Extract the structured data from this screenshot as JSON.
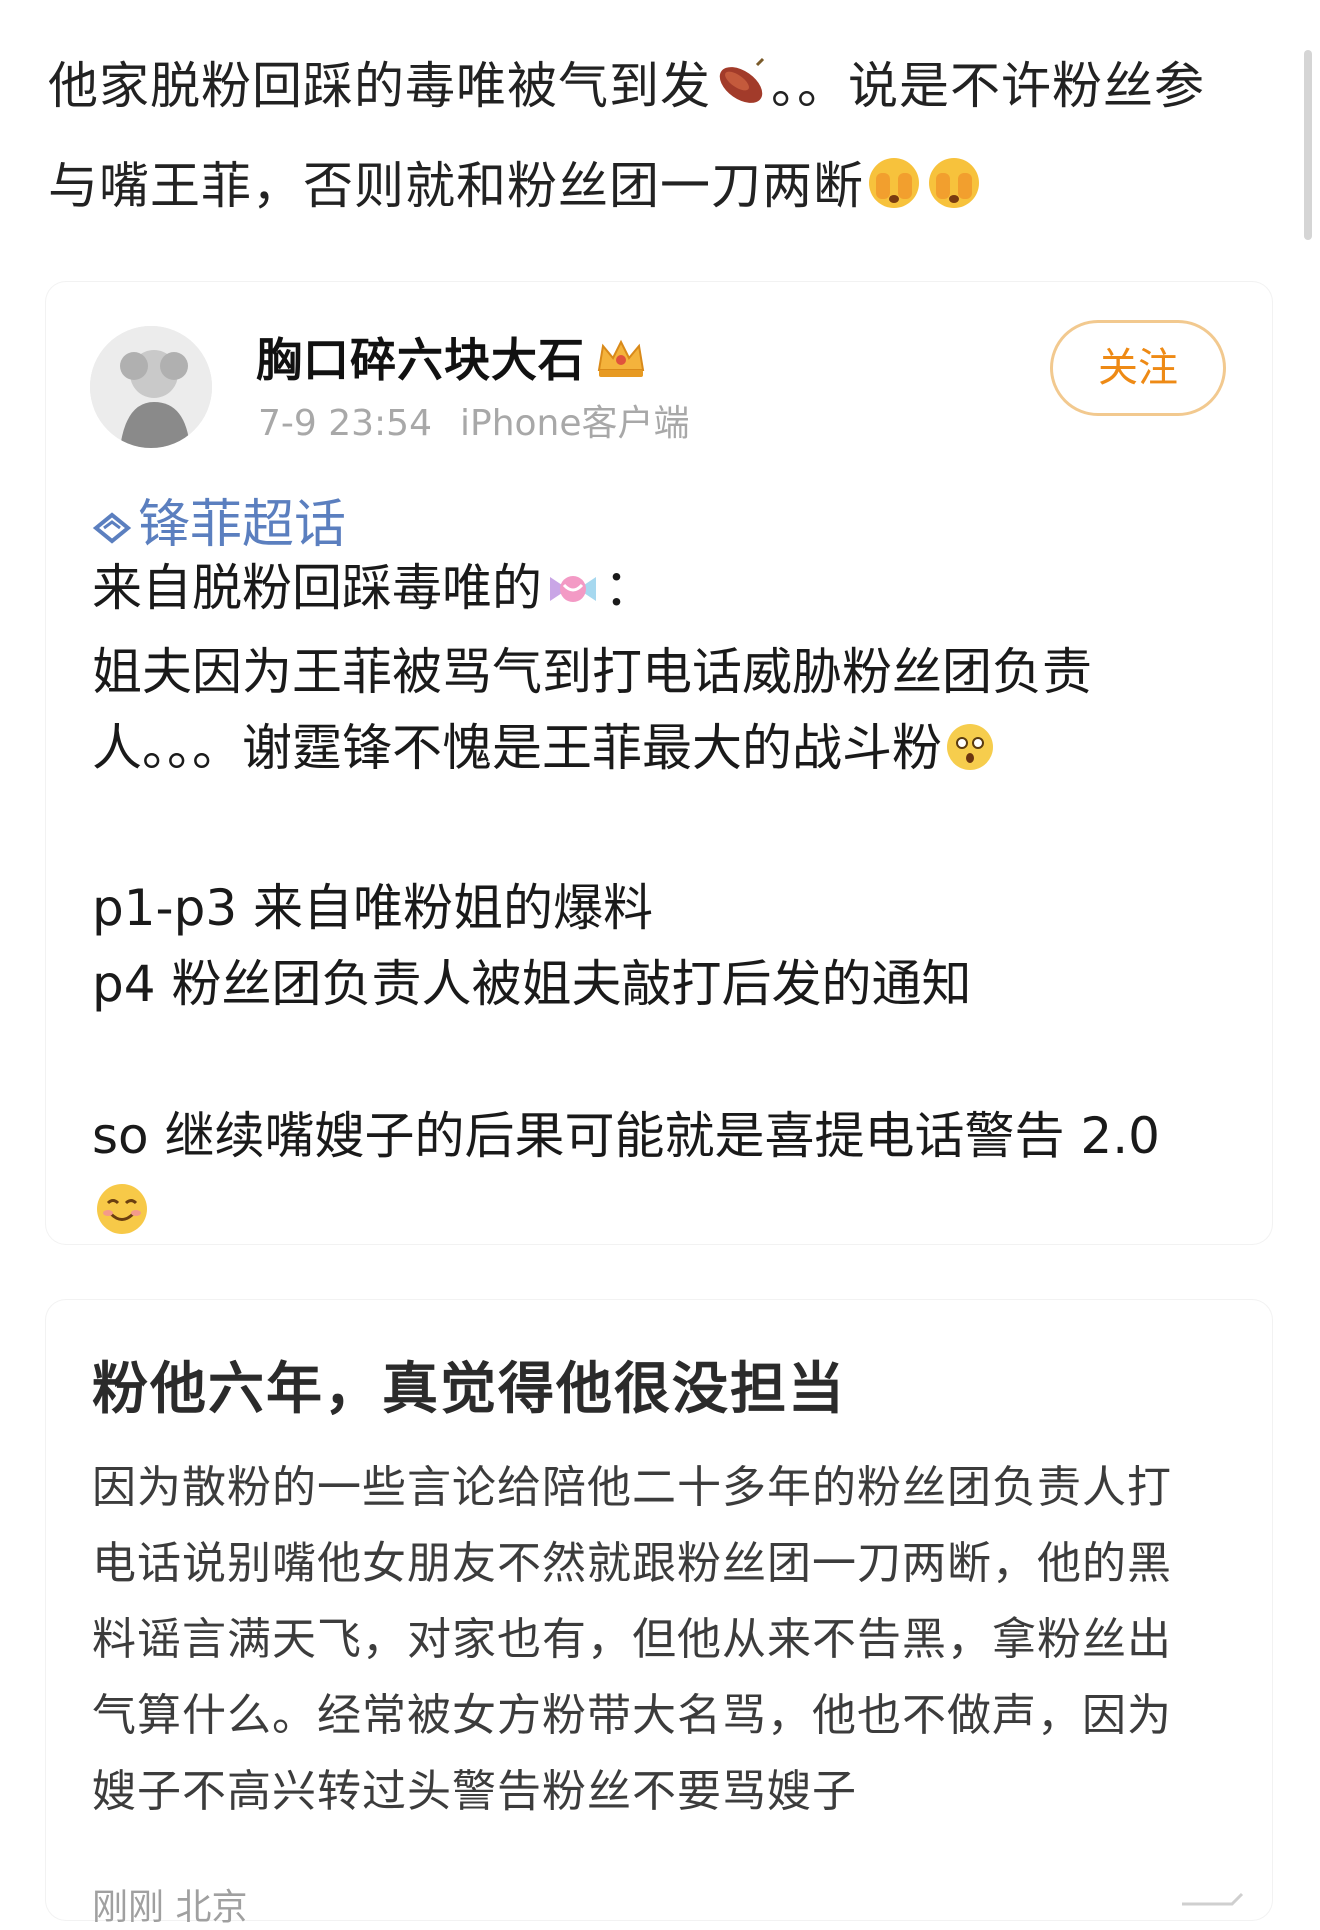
{
  "intro": {
    "line1": "他家脱粉回踩的毒唯被气到发",
    "line1_tail": "。。说是不许粉丝参",
    "line2": "与嘴王菲，否则就和粉丝团一刀两断"
  },
  "post": {
    "username": "胸口碎六块大石",
    "time": "7-9 23:54",
    "source": "iPhone客户端",
    "follow_label": "关注",
    "topic": "锋菲超话",
    "body_line1": "来自脱粉回踩毒唯的",
    "body_line1_tail": "：",
    "body_line2": "姐夫因为王菲被骂气到打电话威胁粉丝团负责",
    "body_line3": "人。。。谢霆锋不愧是王菲最大的战斗粉",
    "body_line4": "p1-p3 来自唯粉姐的爆料",
    "body_line5": "p4 粉丝团负责人被姐夫敲打后发的通知",
    "body_line6": "so 继续嘴嫂子的后果可能就是喜提电话警告 2.0"
  },
  "quoted": {
    "title": "粉他六年，真觉得他很没担当",
    "line1": "因为散粉的一些言论给陪他二十多年的粉丝团负责人打",
    "line2": "电话说别嘴他女朋友不然就跟粉丝团一刀两断，他的黑",
    "line3": "料谣言满天飞，对家也有，但他从来不告黑，拿粉丝出",
    "line4": "气算什么。经常被女方粉带大名骂，他也不做声，因为",
    "line5": "嫂子不高兴转过头警告粉丝不要骂嫂子",
    "location": "刚刚 北京"
  },
  "colors": {
    "accent_orange": "#ee8a15",
    "topic_blue": "#5b7fbf",
    "meta_gray": "#a8a8a8"
  },
  "icons": [
    "sweet-potato-icon",
    "face-with-hands-icon",
    "crown-badge-icon",
    "super-topic-icon",
    "candy-icon",
    "astonished-face-icon",
    "smiling-face-icon"
  ]
}
